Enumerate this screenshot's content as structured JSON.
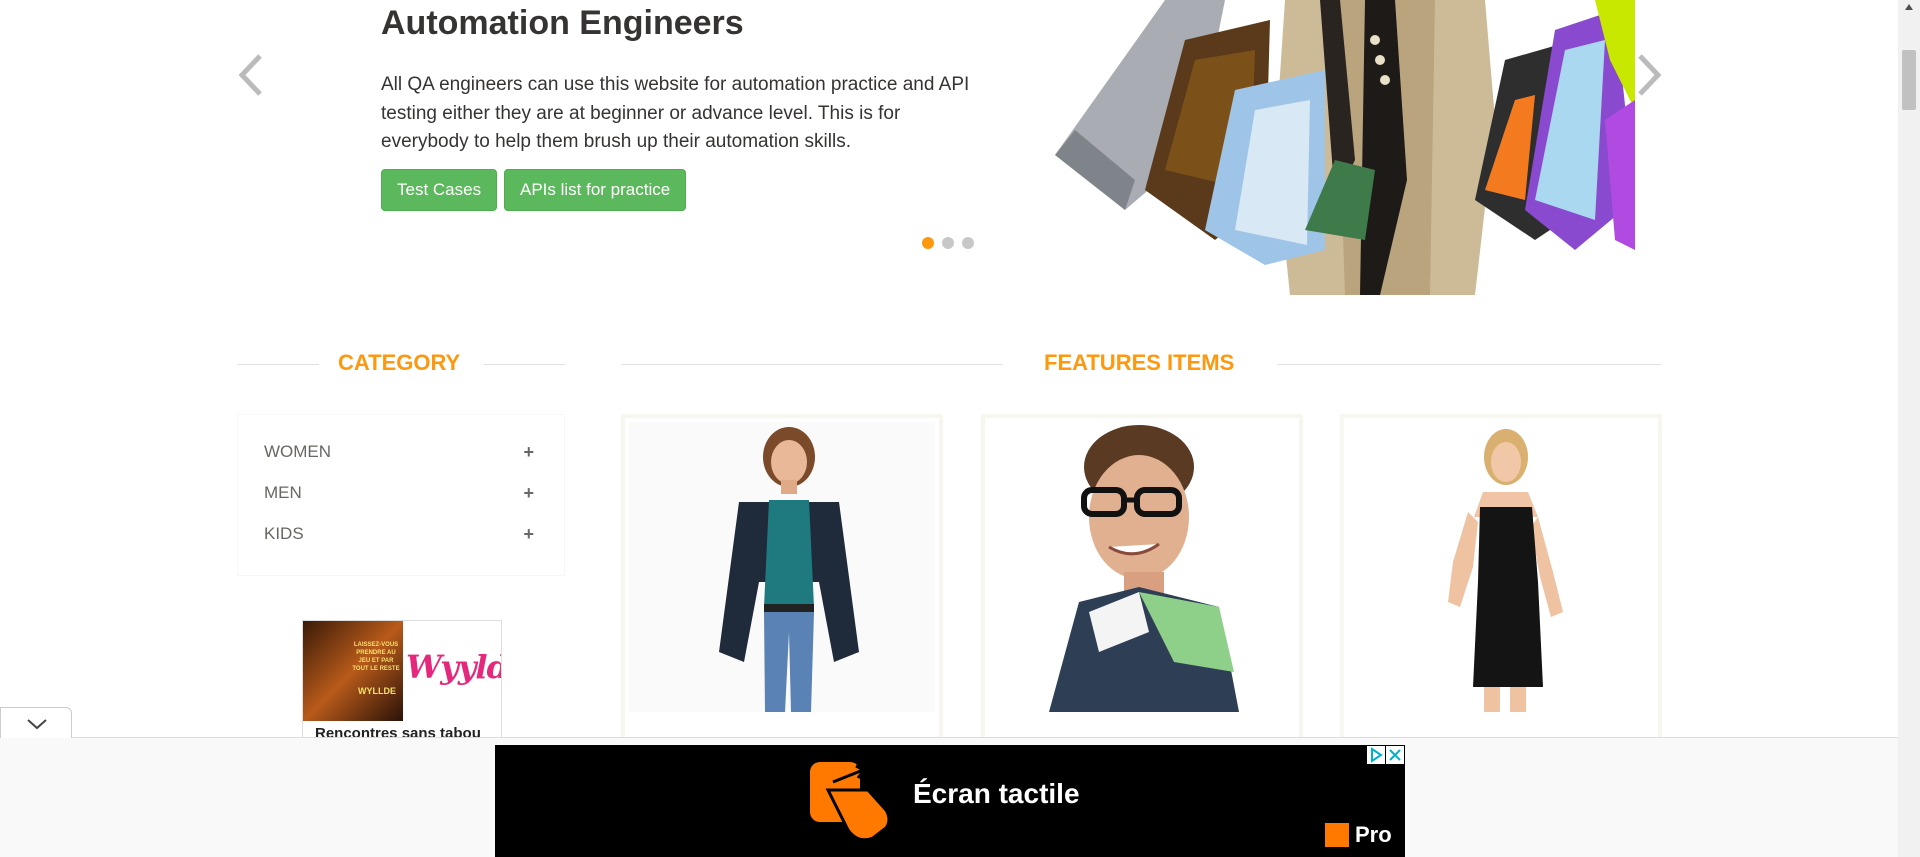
{
  "hero": {
    "heading": "Automation Engineers",
    "description": "All QA engineers can use this website for automation practice and API testing either they are at beginner or advance level. This is for everybody to help them brush up their automation skills.",
    "test_cases_label": "Test Cases",
    "apis_label": "APIs list for practice",
    "slide_count": 3,
    "active_slide": 1
  },
  "category": {
    "title": "CATEGORY",
    "items": [
      {
        "label": "WOMEN",
        "icon": "plus-icon"
      },
      {
        "label": "MEN",
        "icon": "plus-icon"
      },
      {
        "label": "KIDS",
        "icon": "plus-icon"
      }
    ]
  },
  "features": {
    "title": "FEATURES ITEMS"
  },
  "left_ad": {
    "brand": "Wyylde",
    "image_text": "LAISSEZ-VOUS PRENDRE AU JEU ET PAR TOUT LE RESTE",
    "image_brand": "WYLLDE",
    "caption": "Rencontres sans tabou"
  },
  "bottom_ad": {
    "headline": "Écran tactile",
    "pro_label": "Pro",
    "brand_color": "#ff7900"
  },
  "colors": {
    "accent": "#fe980f",
    "button_green": "#5cb85c"
  }
}
